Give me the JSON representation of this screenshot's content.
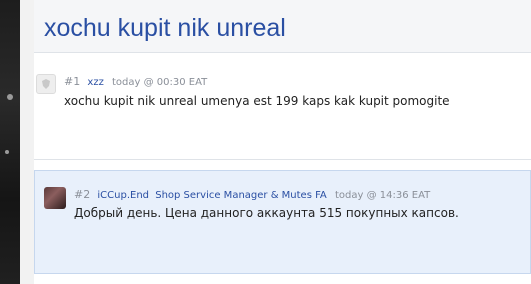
{
  "thread": {
    "title": "xochu kupit nik unreal"
  },
  "posts": [
    {
      "number": "#1",
      "author": "xzz",
      "role": "",
      "time": "today @ 00:30 EAT",
      "text": "xochu kupit nik unreal umenya est 199 kaps kak kupit pomogite",
      "avatar_icon": "default-avatar-icon"
    },
    {
      "number": "#2",
      "author": "iCCup.End",
      "role": "Shop Service Manager & Mutes FA",
      "time": "today @ 14:36 EAT",
      "text": "Добрый день. Цена данного аккаунта 515 покупных капсов.",
      "avatar_icon": "user-avatar-icon"
    }
  ],
  "colors": {
    "accent": "#2a4fa3",
    "highlight_post_bg": "#e8f0fb"
  }
}
